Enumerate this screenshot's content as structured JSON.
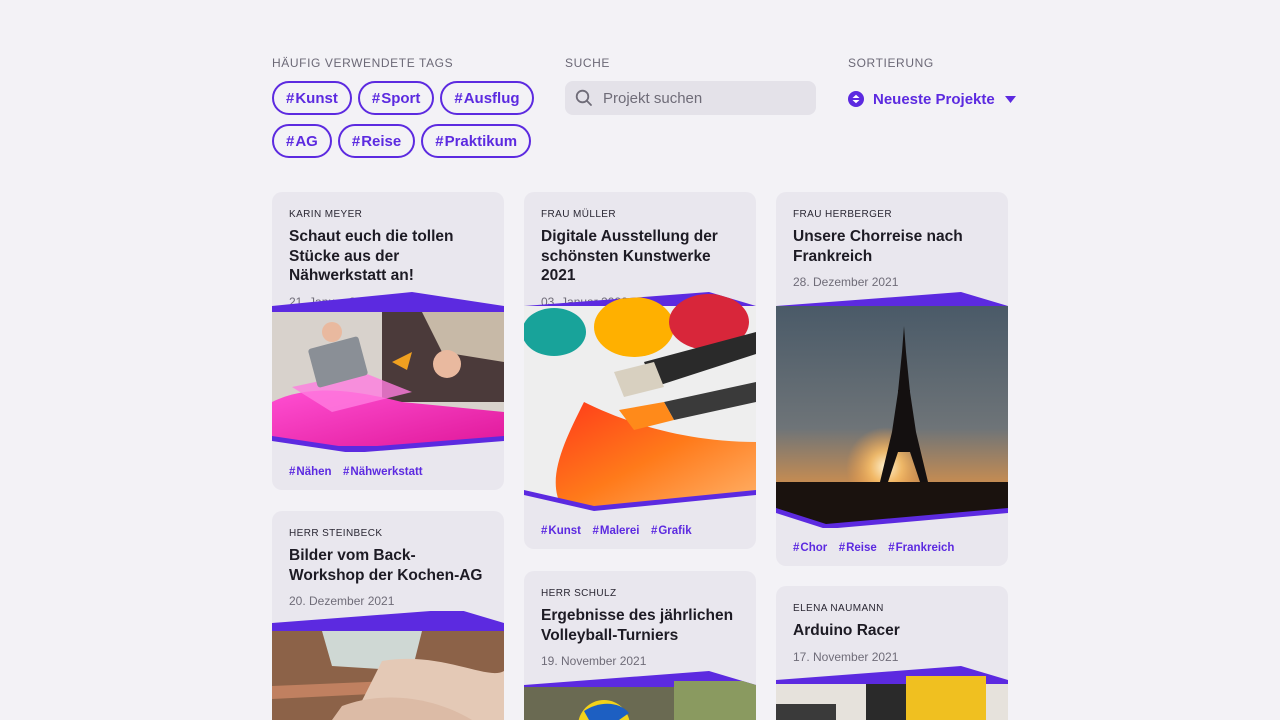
{
  "filters": {
    "tags_label": "Häufig verwendete Tags",
    "search_label": "Suche",
    "sort_label": "Sortierung",
    "tags": [
      "Kunst",
      "Sport",
      "Ausflug",
      "AG",
      "Reise",
      "Praktikum"
    ],
    "search_placeholder": "Projekt suchen",
    "sort_value": "Neueste Projekte"
  },
  "hash": "#",
  "colors": {
    "accent": "#5c2ae0",
    "background": "#f3f2f6",
    "card": "#e9e7ee"
  },
  "cards": [
    {
      "author": "Karin Meyer",
      "title": "Schaut euch die tollen Stücke aus der Nähwerkstatt an!",
      "date": "21. Januar 2022",
      "tags": [
        "Nähen",
        "Nähwerkstatt"
      ],
      "image": "sewing-photo"
    },
    {
      "author": "Frau Müller",
      "title": "Digitale Ausstellung der schönsten Kunstwerke 2021",
      "date": "03. Januar 2022",
      "tags": [
        "Kunst",
        "Malerei",
        "Grafik"
      ],
      "image": "paint-brush-photo"
    },
    {
      "author": "Frau Herberger",
      "title": "Unsere Chorreise nach Frankreich",
      "date": "28. Dezember 2021",
      "tags": [
        "Chor",
        "Reise",
        "Frankreich"
      ],
      "image": "eiffel-tower-photo"
    },
    {
      "author": "Herr Steinbeck",
      "title": "Bilder vom Back-Workshop der Kochen-AG",
      "date": "20. Dezember 2021",
      "tags": [],
      "image": "baking-photo"
    },
    {
      "author": "Herr Schulz",
      "title": "Ergebnisse des jährlichen Volleyball-Turniers",
      "date": "19. November 2021",
      "tags": [],
      "image": "volleyball-photo"
    },
    {
      "author": "Elena Naumann",
      "title": "Arduino Racer",
      "date": "17. November 2021",
      "tags": [],
      "image": "arduino-photo"
    }
  ]
}
